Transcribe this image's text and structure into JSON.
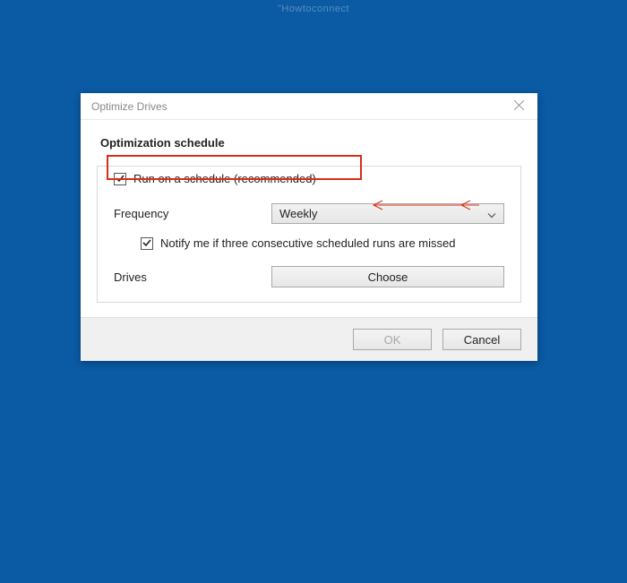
{
  "watermark": "\"Howtoconnect",
  "dialog": {
    "title": "Optimize Drives",
    "section_title": "Optimization schedule",
    "run_on_schedule_label": "Run on a schedule (recommended)",
    "frequency_label": "Frequency",
    "frequency_value": "Weekly",
    "notify_label": "Notify me if three consecutive scheduled runs are missed",
    "drives_label": "Drives",
    "choose_button": "Choose",
    "ok_button": "OK",
    "cancel_button": "Cancel"
  }
}
